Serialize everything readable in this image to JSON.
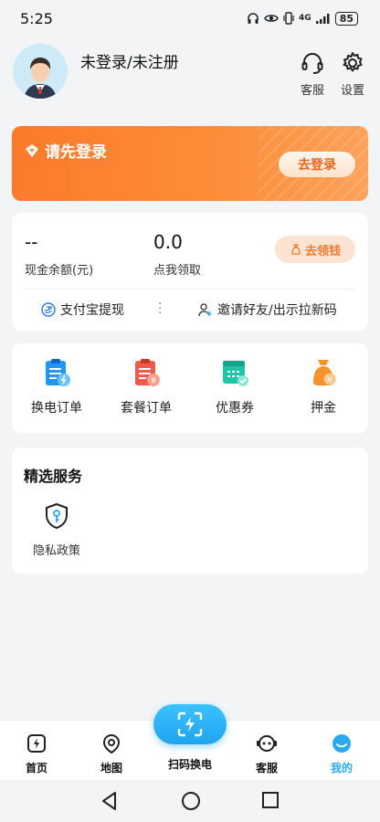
{
  "status_bar": {
    "time": "5:25",
    "network": "4G",
    "battery": "85"
  },
  "profile": {
    "username": "未登录/未注册",
    "customer_service_label": "客服",
    "settings_label": "设置"
  },
  "login_banner": {
    "title": "请先登录",
    "button_label": "去登录"
  },
  "wallet": {
    "cash_balance_value": "--",
    "cash_balance_label": "现金余额(元)",
    "claim_value": "0.0",
    "claim_label": "点我领取",
    "claim_button": "去领钱",
    "alipay_withdraw": "支付宝提现",
    "invite_friends": "邀请好友/出示拉新码"
  },
  "orders": [
    {
      "label": "换电订单",
      "icon": "battery-swap-order-icon",
      "color": "#2196f3"
    },
    {
      "label": "套餐订单",
      "icon": "package-order-icon",
      "color": "#f05a4a"
    },
    {
      "label": "优惠券",
      "icon": "coupon-icon",
      "color": "#1dc6a8"
    },
    {
      "label": "押金",
      "icon": "deposit-bag-icon",
      "color": "#f5922e"
    }
  ],
  "services": {
    "title": "精选服务",
    "items": [
      {
        "label": "隐私政策",
        "icon": "privacy-shield-icon"
      }
    ]
  },
  "tabbar": {
    "home": "首页",
    "map": "地图",
    "scan": "扫码换电",
    "service": "客服",
    "mine": "我的",
    "active_color": "#2aa8f0"
  },
  "colors": {
    "accent": "#fc7a2c",
    "primary": "#2aa8f0"
  }
}
